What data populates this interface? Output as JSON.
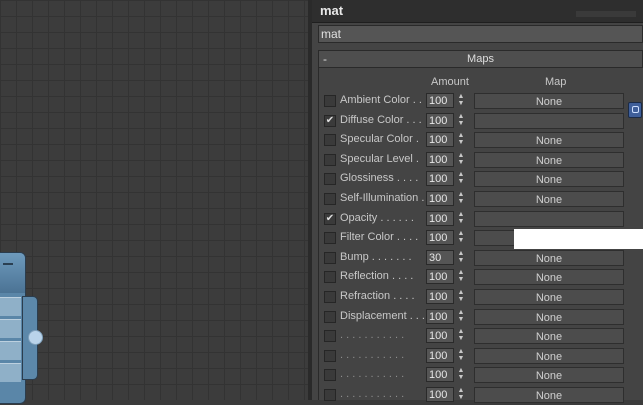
{
  "viewport": {
    "background": "#3c3c3c"
  },
  "panel": {
    "title": "mat",
    "name_value": "mat",
    "rollout": {
      "toggle": "-",
      "title": "Maps"
    },
    "columns": {
      "amount": "Amount",
      "map": "Map"
    },
    "rows": [
      {
        "label": "Ambient Color . .",
        "checked": false,
        "amount": "100",
        "map": "None",
        "enabled": true
      },
      {
        "label": "Diffuse Color . . .",
        "checked": true,
        "amount": "100",
        "map": "",
        "enabled": true
      },
      {
        "label": "Specular Color  .",
        "checked": false,
        "amount": "100",
        "map": "None",
        "enabled": true
      },
      {
        "label": "Specular Level  .",
        "checked": false,
        "amount": "100",
        "map": "None",
        "enabled": true
      },
      {
        "label": "Glossiness  . . . .",
        "checked": false,
        "amount": "100",
        "map": "None",
        "enabled": true
      },
      {
        "label": "Self-Illumination .",
        "checked": false,
        "amount": "100",
        "map": "None",
        "enabled": true
      },
      {
        "label": "Opacity . . . . . .",
        "checked": true,
        "amount": "100",
        "map": "",
        "enabled": true
      },
      {
        "label": "Filter Color  . . . .",
        "checked": false,
        "amount": "100",
        "map": "",
        "enabled": true
      },
      {
        "label": "Bump  . . . . . . .",
        "checked": false,
        "amount": "30",
        "map": "None",
        "enabled": true
      },
      {
        "label": "Reflection  . . . .",
        "checked": false,
        "amount": "100",
        "map": "None",
        "enabled": true
      },
      {
        "label": "Refraction  . . . .",
        "checked": false,
        "amount": "100",
        "map": "None",
        "enabled": true
      },
      {
        "label": "Displacement  . . .",
        "checked": false,
        "amount": "100",
        "map": "None",
        "enabled": true
      },
      {
        "label": ". . . . . . . . . . .",
        "checked": false,
        "amount": "100",
        "map": "None",
        "enabled": false
      },
      {
        "label": ". . . . . . . . . . .",
        "checked": false,
        "amount": "100",
        "map": "None",
        "enabled": false
      },
      {
        "label": ". . . . . . . . . . .",
        "checked": false,
        "amount": "100",
        "map": "None",
        "enabled": false
      },
      {
        "label": ". . . . . . . . . . .",
        "checked": false,
        "amount": "100",
        "map": "None",
        "enabled": false
      }
    ],
    "check_glyph": "✔",
    "spinner_glyph": "▲▼"
  }
}
